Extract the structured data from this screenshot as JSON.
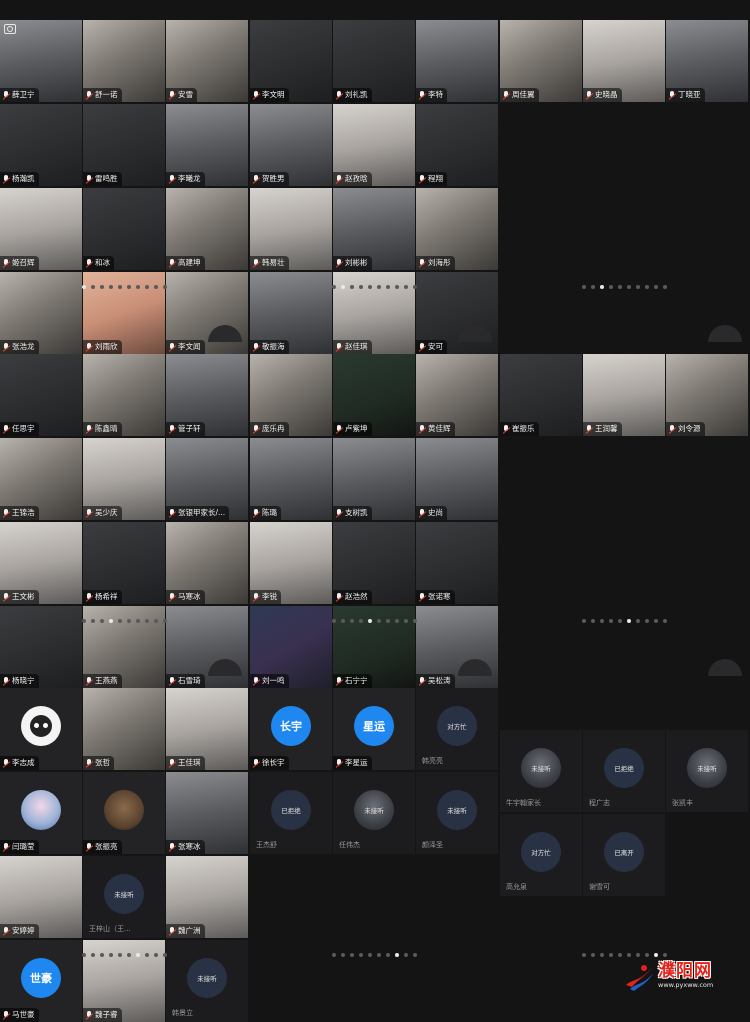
{
  "screens": [
    {
      "id": "s1",
      "tiles": [
        {
          "name": "薛卫宁",
          "kind": "video",
          "tone": "v1",
          "camera": true
        },
        {
          "name": "舒一诺",
          "kind": "video",
          "tone": "v2"
        },
        {
          "name": "安雪",
          "kind": "video",
          "tone": "v2"
        },
        {
          "name": "杨瀚凯",
          "kind": "video",
          "tone": "v3"
        },
        {
          "name": "雷鸣胜",
          "kind": "video",
          "tone": "v3"
        },
        {
          "name": "李曦龙",
          "kind": "video",
          "tone": "v1"
        },
        {
          "name": "姬召辉",
          "kind": "video",
          "tone": "v4"
        },
        {
          "name": "和冰",
          "kind": "video",
          "tone": "v3"
        },
        {
          "name": "高建坤",
          "kind": "video",
          "tone": "v2"
        },
        {
          "name": "张浩龙",
          "kind": "video",
          "tone": "v2"
        },
        {
          "name": "刘雨欣",
          "kind": "video",
          "tone": "v6"
        },
        {
          "name": "李文闻",
          "kind": "video",
          "tone": "v2"
        }
      ],
      "dots": 10,
      "active": 0
    },
    {
      "id": "s2",
      "tiles": [
        {
          "name": "李文明",
          "kind": "video",
          "tone": "v3"
        },
        {
          "name": "刘礼凯",
          "kind": "video",
          "tone": "v3"
        },
        {
          "name": "李特",
          "kind": "video",
          "tone": "v1"
        },
        {
          "name": "贺胜男",
          "kind": "video",
          "tone": "v1"
        },
        {
          "name": "赵孜晗",
          "kind": "video",
          "tone": "v4"
        },
        {
          "name": "程翔",
          "kind": "video",
          "tone": "v3"
        },
        {
          "name": "韩易壮",
          "kind": "video",
          "tone": "v4"
        },
        {
          "name": "刘彬彬",
          "kind": "video",
          "tone": "v1"
        },
        {
          "name": "刘海彤",
          "kind": "video",
          "tone": "v2"
        },
        {
          "name": "敬振海",
          "kind": "video",
          "tone": "v1"
        },
        {
          "name": "赵佳琪",
          "kind": "video",
          "tone": "v4"
        },
        {
          "name": "安可",
          "kind": "video",
          "tone": "v3"
        }
      ],
      "dots": 10,
      "active": 1
    },
    {
      "id": "s3",
      "tiles": [
        {
          "name": "周佳翼",
          "kind": "video",
          "tone": "v2"
        },
        {
          "name": "史晓晶",
          "kind": "video",
          "tone": "v4"
        },
        {
          "name": "丁晓亚",
          "kind": "video",
          "tone": "v1"
        }
      ],
      "dots": 10,
      "active": 2
    },
    {
      "id": "s4",
      "tiles": [
        {
          "name": "任思宇",
          "kind": "video",
          "tone": "v3"
        },
        {
          "name": "陈鑫晴",
          "kind": "video",
          "tone": "v2"
        },
        {
          "name": "管子轩",
          "kind": "video",
          "tone": "v1"
        },
        {
          "name": "王锦浩",
          "kind": "video",
          "tone": "v2"
        },
        {
          "name": "吴少庆",
          "kind": "video",
          "tone": "v4"
        },
        {
          "name": "张银甲家长/...",
          "kind": "video",
          "tone": "v1"
        },
        {
          "name": "王文彬",
          "kind": "video",
          "tone": "v4"
        },
        {
          "name": "杨希祥",
          "kind": "video",
          "tone": "v3"
        },
        {
          "name": "马寒冰",
          "kind": "video",
          "tone": "v2"
        },
        {
          "name": "杨晓宁",
          "kind": "video",
          "tone": "v3"
        },
        {
          "name": "王燕燕",
          "kind": "video",
          "tone": "v2"
        },
        {
          "name": "石雪琦",
          "kind": "video",
          "tone": "v1"
        }
      ],
      "dots": 10,
      "active": 3
    },
    {
      "id": "s5",
      "tiles": [
        {
          "name": "庞乐冉",
          "kind": "video",
          "tone": "v2"
        },
        {
          "name": "卢紫坤",
          "kind": "video",
          "tone": "v7"
        },
        {
          "name": "黄佳辉",
          "kind": "video",
          "tone": "v2"
        },
        {
          "name": "陈璐",
          "kind": "video",
          "tone": "v1"
        },
        {
          "name": "支树凯",
          "kind": "video",
          "tone": "v1"
        },
        {
          "name": "史尚",
          "kind": "video",
          "tone": "v1"
        },
        {
          "name": "李锐",
          "kind": "video",
          "tone": "v4"
        },
        {
          "name": "赵浩然",
          "kind": "video",
          "tone": "v3"
        },
        {
          "name": "张诺寒",
          "kind": "video",
          "tone": "v3"
        },
        {
          "name": "刘一鸣",
          "kind": "video",
          "tone": "v5"
        },
        {
          "name": "石宁宁",
          "kind": "video",
          "tone": "v7"
        },
        {
          "name": "吴松涛",
          "kind": "video",
          "tone": "v1"
        }
      ],
      "dots": 10,
      "active": 4
    },
    {
      "id": "s6",
      "tiles": [
        {
          "name": "崔振乐",
          "kind": "video",
          "tone": "v3"
        },
        {
          "name": "王润馨",
          "kind": "video",
          "tone": "v4"
        },
        {
          "name": "刘令源",
          "kind": "video",
          "tone": "v2"
        }
      ],
      "dots": 10,
      "active": 5
    },
    {
      "id": "s7",
      "tiles": [
        {
          "name": "李志成",
          "kind": "avatar",
          "avatar": "img"
        },
        {
          "name": "张哲",
          "kind": "video",
          "tone": "v2"
        },
        {
          "name": "王佳琪",
          "kind": "video",
          "tone": "v4"
        },
        {
          "name": "闫璐莹",
          "kind": "avatar",
          "avatar": "anime"
        },
        {
          "name": "张振亮",
          "kind": "avatar",
          "avatar": "animal"
        },
        {
          "name": "张寒冰",
          "kind": "video",
          "tone": "v1"
        },
        {
          "name": "安婷婷",
          "kind": "video",
          "tone": "v4"
        },
        {
          "name": "王梓山（王...",
          "kind": "status",
          "status": "未接听"
        },
        {
          "name": "魏广洲",
          "kind": "video",
          "tone": "v4"
        },
        {
          "name": "马世豪",
          "kind": "avatar",
          "avatar": "blue",
          "initials": "世豪"
        },
        {
          "name": "魏子睿",
          "kind": "video",
          "tone": "v4"
        },
        {
          "name": "韩景立",
          "kind": "status",
          "status": "未接听"
        }
      ],
      "dots": 10,
      "active": 6
    },
    {
      "id": "s8",
      "tiles": [
        {
          "name": "徐长宇",
          "kind": "avatar",
          "avatar": "blue",
          "initials": "长宇"
        },
        {
          "name": "李星运",
          "kind": "avatar",
          "avatar": "blue",
          "initials": "星运"
        },
        {
          "name": "韩亮亮",
          "kind": "status",
          "status": "对方忙"
        },
        {
          "name": "王杰舒",
          "kind": "status",
          "status": "已拒绝"
        },
        {
          "name": "任伟杰",
          "kind": "status",
          "status": "未接听",
          "photo": true
        },
        {
          "name": "颜泽圣",
          "kind": "status",
          "status": "未接听"
        }
      ],
      "dots": 10,
      "active": 7
    },
    {
      "id": "s9",
      "tiles": [
        {
          "name": "牛宇翰家长",
          "kind": "status",
          "status": "未接听",
          "photo": true
        },
        {
          "name": "程广志",
          "kind": "status",
          "status": "已拒绝"
        },
        {
          "name": "张凯丰",
          "kind": "status",
          "status": "未接听",
          "photo": true
        },
        {
          "name": "高允泉",
          "kind": "status",
          "status": "对方忙"
        },
        {
          "name": "谢雪可",
          "kind": "status",
          "status": "已离开"
        }
      ],
      "dots": 10,
      "active": 8
    }
  ],
  "watermark": {
    "name": "濮阳网",
    "url": "www.pyxww.com",
    "colors": {
      "red": "#e2231a",
      "blue": "#1e5fc8"
    }
  },
  "icons": {
    "camera": "camera-switch-icon",
    "mic": "mic-muted-icon"
  }
}
